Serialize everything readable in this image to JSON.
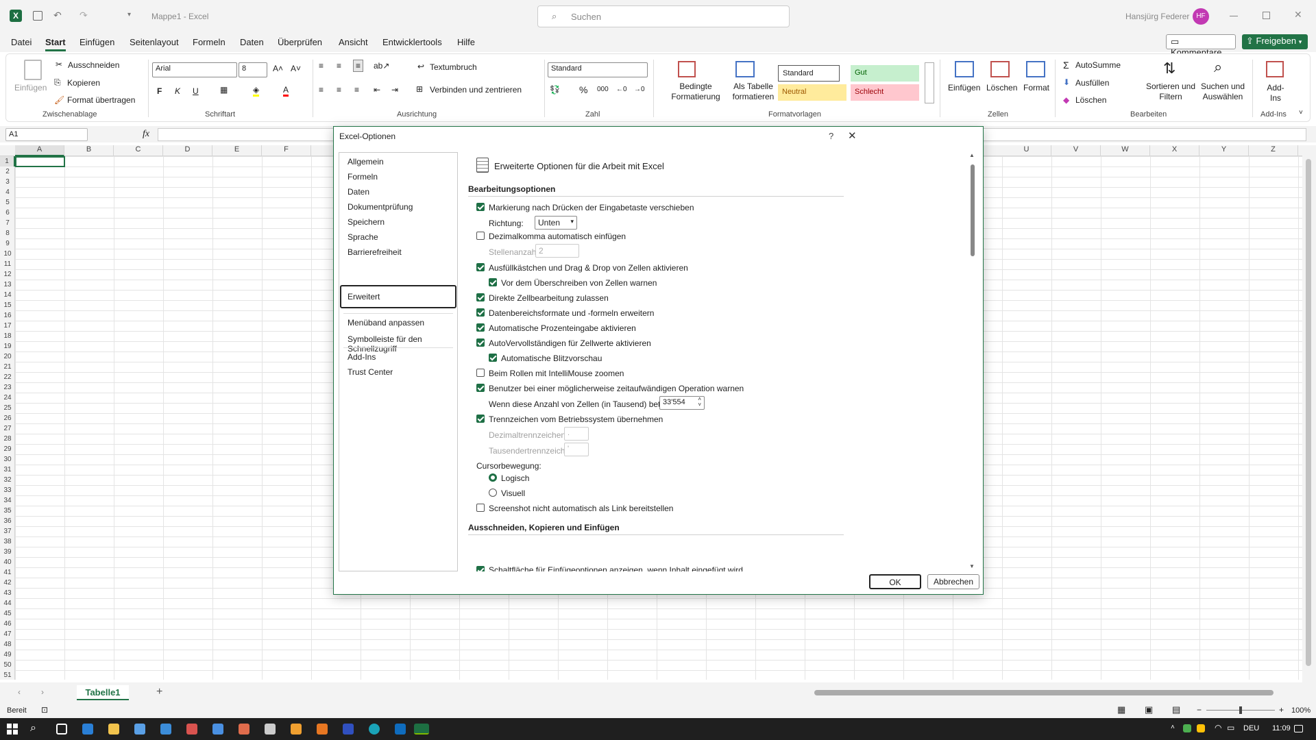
{
  "app": {
    "title": "Mappe1 - Excel",
    "search_placeholder": "Suchen",
    "user_name": "Hansjürg Federer",
    "user_initials": "HF"
  },
  "menu": {
    "items": [
      "Datei",
      "Start",
      "Einfügen",
      "Seitenlayout",
      "Formeln",
      "Daten",
      "Überprüfen",
      "Ansicht",
      "Entwicklertools",
      "Hilfe"
    ],
    "comments": "Kommentare",
    "share": "Freigeben"
  },
  "ribbon": {
    "clipboard": {
      "paste": "Einfügen",
      "cut": "Ausschneiden",
      "copy": "Kopieren",
      "format_painter": "Format übertragen",
      "group": "Zwischenablage"
    },
    "font": {
      "name": "Arial",
      "size": "8",
      "group": "Schriftart",
      "bold": "F",
      "italic": "K",
      "underline": "U"
    },
    "alignment": {
      "wrap": "Textumbruch",
      "merge": "Verbinden und zentrieren",
      "group": "Ausrichtung"
    },
    "number": {
      "format": "Standard",
      "group": "Zahl"
    },
    "styles": {
      "conditional": "Bedingte Formatierung",
      "as_table": "Als Tabelle formatieren",
      "standard": "Standard",
      "gut": "Gut",
      "neutral": "Neutral",
      "schlecht": "Schlecht",
      "group": "Formatvorlagen"
    },
    "cells": {
      "insert": "Einfügen",
      "delete": "Löschen",
      "format": "Format",
      "group": "Zellen"
    },
    "editing": {
      "autosum": "AutoSumme",
      "fill": "Ausfüllen",
      "clear": "Löschen",
      "sort": "Sortieren und Filtern",
      "find": "Suchen und Auswählen",
      "group": "Bearbeiten"
    },
    "addins": {
      "label": "Add-Ins",
      "group": "Add-Ins"
    }
  },
  "formula_bar": {
    "name_box": "A1",
    "fx": "fx"
  },
  "columns": [
    "A",
    "B",
    "C",
    "D",
    "E",
    "F",
    "U",
    "V",
    "W",
    "X",
    "Y",
    "Z"
  ],
  "rows": [
    "1",
    "2",
    "3",
    "4",
    "5",
    "6",
    "7",
    "8",
    "9",
    "10",
    "11",
    "12",
    "13",
    "14",
    "15",
    "16",
    "17",
    "18",
    "19",
    "20",
    "21",
    "22",
    "23",
    "24",
    "25",
    "26",
    "27",
    "28",
    "29",
    "30",
    "31",
    "32",
    "33",
    "34",
    "35",
    "36",
    "37",
    "38",
    "39",
    "40",
    "41",
    "42",
    "43",
    "44",
    "45",
    "46",
    "47",
    "48",
    "49",
    "50",
    "51"
  ],
  "sheet": {
    "tab": "Tabelle1"
  },
  "status": {
    "ready": "Bereit",
    "zoom": "100%"
  },
  "taskbar": {
    "lang": "DEU",
    "time": "11:09"
  },
  "dialog": {
    "title": "Excel-Optionen",
    "help": "?",
    "close": "✕",
    "nav": [
      "Allgemein",
      "Formeln",
      "Daten",
      "Dokumentprüfung",
      "Speichern",
      "Sprache",
      "Barrierefreiheit",
      "Erweitert",
      "Menüband anpassen",
      "Symbolleiste für den Schnellzugriff",
      "Add-Ins",
      "Trust Center"
    ],
    "header": "Erweiterte Optionen für die Arbeit mit Excel",
    "section1": "Bearbeitungsoptionen",
    "opt1": "Markierung nach Drücken der Eingabetaste verschieben",
    "direction_label": "Richtung:",
    "direction_value": "Unten",
    "opt2": "Dezimalkomma automatisch einfügen",
    "places_label": "Stellenanzahl:",
    "places_value": "2",
    "opt3": "Ausfüllkästchen und Drag & Drop von Zellen aktivieren",
    "opt3a": "Vor dem Überschreiben von Zellen warnen",
    "opt4": "Direkte Zellbearbeitung zulassen",
    "opt5": "Datenbereichsformate und -formeln erweitern",
    "opt6": "Automatische Prozenteingabe aktivieren",
    "opt7": "AutoVervollständigen für Zellwerte aktivieren",
    "opt7a": "Automatische Blitzvorschau",
    "opt8": "Beim Rollen mit IntelliMouse zoomen",
    "opt9": "Benutzer bei einer möglicherweise zeitaufwändigen Operation warnen",
    "cells_label": "Wenn diese Anzahl von Zellen (in Tausend) betroffen ist:",
    "cells_value": "33'554",
    "opt10": "Trennzeichen vom Betriebssystem übernehmen",
    "decimal_label": "Dezimaltrennzeichen:",
    "decimal_value": ".",
    "thousands_label": "Tausendertrennzeichen:",
    "thousands_value": "'",
    "cursor_label": "Cursorbewegung:",
    "logical": "Logisch",
    "visual": "Visuell",
    "opt11": "Screenshot nicht automatisch als Link bereitstellen",
    "section2": "Ausschneiden, Kopieren und Einfügen",
    "opt12": "Schaltfläche für Einfügeoptionen anzeigen, wenn Inhalt eingefügt wird",
    "ok": "OK",
    "cancel": "Abbrechen"
  },
  "colors": {
    "accent": "#217346",
    "checkbox": "#1e6f45",
    "gut": "#c6efce",
    "neutral": "#ffeb9c",
    "schlecht": "#ffc7ce"
  }
}
